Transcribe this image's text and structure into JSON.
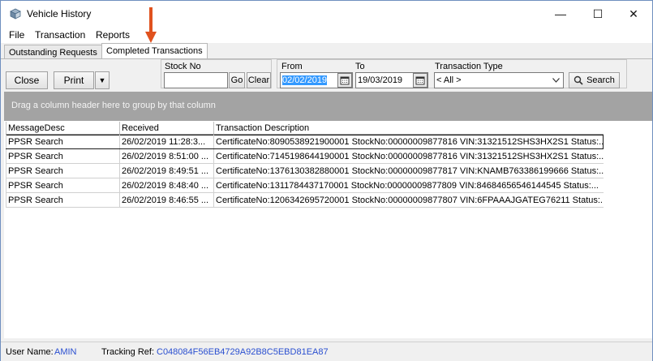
{
  "window": {
    "title": "Vehicle History",
    "minimize": "—",
    "maximize": "☐",
    "close": "✕"
  },
  "menu": {
    "items": [
      "File",
      "Transaction",
      "Reports"
    ]
  },
  "tabs": [
    "Outstanding Requests",
    "Completed Transactions"
  ],
  "toolbar": {
    "close_label": "Close",
    "print_label": "Print",
    "print_dropdown": "▼",
    "stock_no_label": "Stock No",
    "stock_no_value": "",
    "go_label": "Go",
    "clear_label": "Clear",
    "from_label": "From",
    "from_value": "02/02/2019",
    "to_label": "To",
    "to_value": "19/03/2019",
    "transaction_type_label": "Transaction Type",
    "transaction_type_value": "< All >",
    "search_label": "Search"
  },
  "group_header": "Drag a column header here to group by that column",
  "grid": {
    "columns": [
      "MessageDesc",
      "Received",
      "Transaction Description"
    ],
    "rows": [
      [
        "PPSR Search",
        "26/02/2019 11:28:3...",
        "CertificateNo:8090538921900001 StockNo:00000009877816  VIN:31321512SHS3HX2S1 Status:..."
      ],
      [
        "PPSR Search",
        "26/02/2019 8:51:00 ...",
        "CertificateNo:7145198644190001 StockNo:00000009877816  VIN:31321512SHS3HX2S1 Status:..."
      ],
      [
        "PPSR Search",
        "26/02/2019 8:49:51 ...",
        "CertificateNo:1376130382880001 StockNo:00000009877817  VIN:KNAMB763386199666 Status:..."
      ],
      [
        "PPSR Search",
        "26/02/2019 8:48:40 ...",
        "CertificateNo:1311784437170001 StockNo:00000009877809  VIN:84684656546144545 Status:..."
      ],
      [
        "PPSR Search",
        "26/02/2019 8:46:55 ...",
        "CertificateNo:1206342695720001 StockNo:00000009877807  VIN:6FPAAAJGATEG76211 Status:..."
      ]
    ]
  },
  "status": {
    "user_label": "User Name:",
    "user_value": "AMIN",
    "tracking_label": "Tracking Ref:",
    "tracking_value": "C048084F56EB4729A92B8C5EBD81EA87"
  },
  "colors": {
    "arrow": "#e0521e",
    "status_value": "#2a4fd0",
    "selection": "#3399ff"
  }
}
